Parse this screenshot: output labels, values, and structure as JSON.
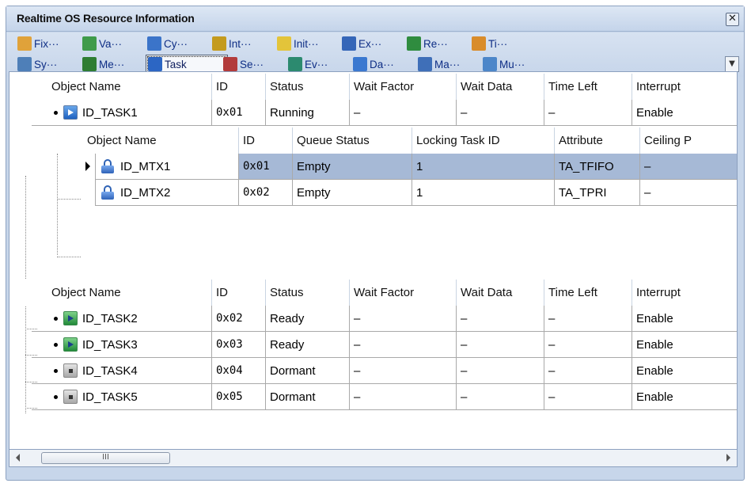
{
  "window": {
    "title": "Realtime OS Resource Information"
  },
  "toolbar": {
    "row1": [
      {
        "label": "Fix···",
        "icon": "fixed-memory-icon"
      },
      {
        "label": "Va···",
        "icon": "variable-memory-icon"
      },
      {
        "label": "Cy···",
        "icon": "cyclic-handler-icon"
      },
      {
        "label": "Int···",
        "icon": "interrupt-handler-icon"
      },
      {
        "label": "Init···",
        "icon": "init-routine-icon"
      },
      {
        "label": "Ex···",
        "icon": "exception-icon"
      },
      {
        "label": "Re···",
        "icon": "ready-queue-icon"
      },
      {
        "label": "Ti···",
        "icon": "timer-queue-icon"
      }
    ],
    "row2": [
      {
        "label": "Sy···",
        "icon": "system-icon"
      },
      {
        "label": "Me···",
        "icon": "memory-icon"
      },
      {
        "label": "Task",
        "icon": "task-icon",
        "active": true
      },
      {
        "label": "Se···",
        "icon": "semaphore-icon"
      },
      {
        "label": "Ev···",
        "icon": "eventflag-icon"
      },
      {
        "label": "Da···",
        "icon": "dataqueue-icon"
      },
      {
        "label": "Ma···",
        "icon": "mailbox-icon"
      },
      {
        "label": "Mu···",
        "icon": "mutex-icon"
      }
    ]
  },
  "task_columns": [
    "Object Name",
    "ID",
    "Status",
    "Wait Factor",
    "Wait Data",
    "Time Left",
    "Interrupt"
  ],
  "mutex_columns": [
    "Object Name",
    "ID",
    "Queue Status",
    "Locking Task ID",
    "Attribute",
    "Ceiling P"
  ],
  "task1": {
    "name": "ID_TASK1",
    "id": "0x01",
    "status": "Running",
    "wait_factor": "–",
    "wait_data": "–",
    "time_left": "–",
    "interrupt": "Enable",
    "state": "running"
  },
  "mutexes": [
    {
      "name": "ID_MTX1",
      "id": "0x01",
      "queue_status": "Empty",
      "locking_task_id": "1",
      "attribute": "TA_TFIFO",
      "ceiling": "–",
      "selected": true
    },
    {
      "name": "ID_MTX2",
      "id": "0x02",
      "queue_status": "Empty",
      "locking_task_id": "1",
      "attribute": "TA_TPRI",
      "ceiling": "–"
    }
  ],
  "tasks": [
    {
      "name": "ID_TASK2",
      "id": "0x02",
      "status": "Ready",
      "wait_factor": "–",
      "wait_data": "–",
      "time_left": "–",
      "interrupt": "Enable",
      "state": "ready"
    },
    {
      "name": "ID_TASK3",
      "id": "0x03",
      "status": "Ready",
      "wait_factor": "–",
      "wait_data": "–",
      "time_left": "–",
      "interrupt": "Enable",
      "state": "ready"
    },
    {
      "name": "ID_TASK4",
      "id": "0x04",
      "status": "Dormant",
      "wait_factor": "–",
      "wait_data": "–",
      "time_left": "–",
      "interrupt": "Enable",
      "state": "dormant"
    },
    {
      "name": "ID_TASK5",
      "id": "0x05",
      "status": "Dormant",
      "wait_factor": "–",
      "wait_data": "–",
      "time_left": "–",
      "interrupt": "Enable",
      "state": "dormant"
    }
  ],
  "scrollbar": {
    "thumb_grip": "III"
  },
  "colors": {
    "selection": "#a6b9d6",
    "panel": "#c7d6ea",
    "link_text": "#0d2d85"
  }
}
